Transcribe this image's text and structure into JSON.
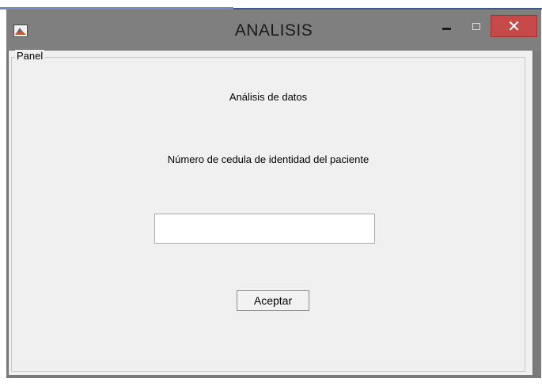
{
  "window": {
    "title": "ANALISIS",
    "controls": {
      "minimize_icon": "minimize-icon",
      "maximize_icon": "maximize-icon",
      "close_symbol": "✕"
    }
  },
  "panel": {
    "legend": "Panel"
  },
  "form": {
    "heading": "Análisis de datos",
    "cedula_label": "Número de cedula de identidad del paciente",
    "cedula_value": "",
    "accept_label": "Aceptar"
  },
  "colors": {
    "close_button": "#c74a4a",
    "titlebar": "#7f7f7f",
    "client_background": "#f0f0f0"
  }
}
